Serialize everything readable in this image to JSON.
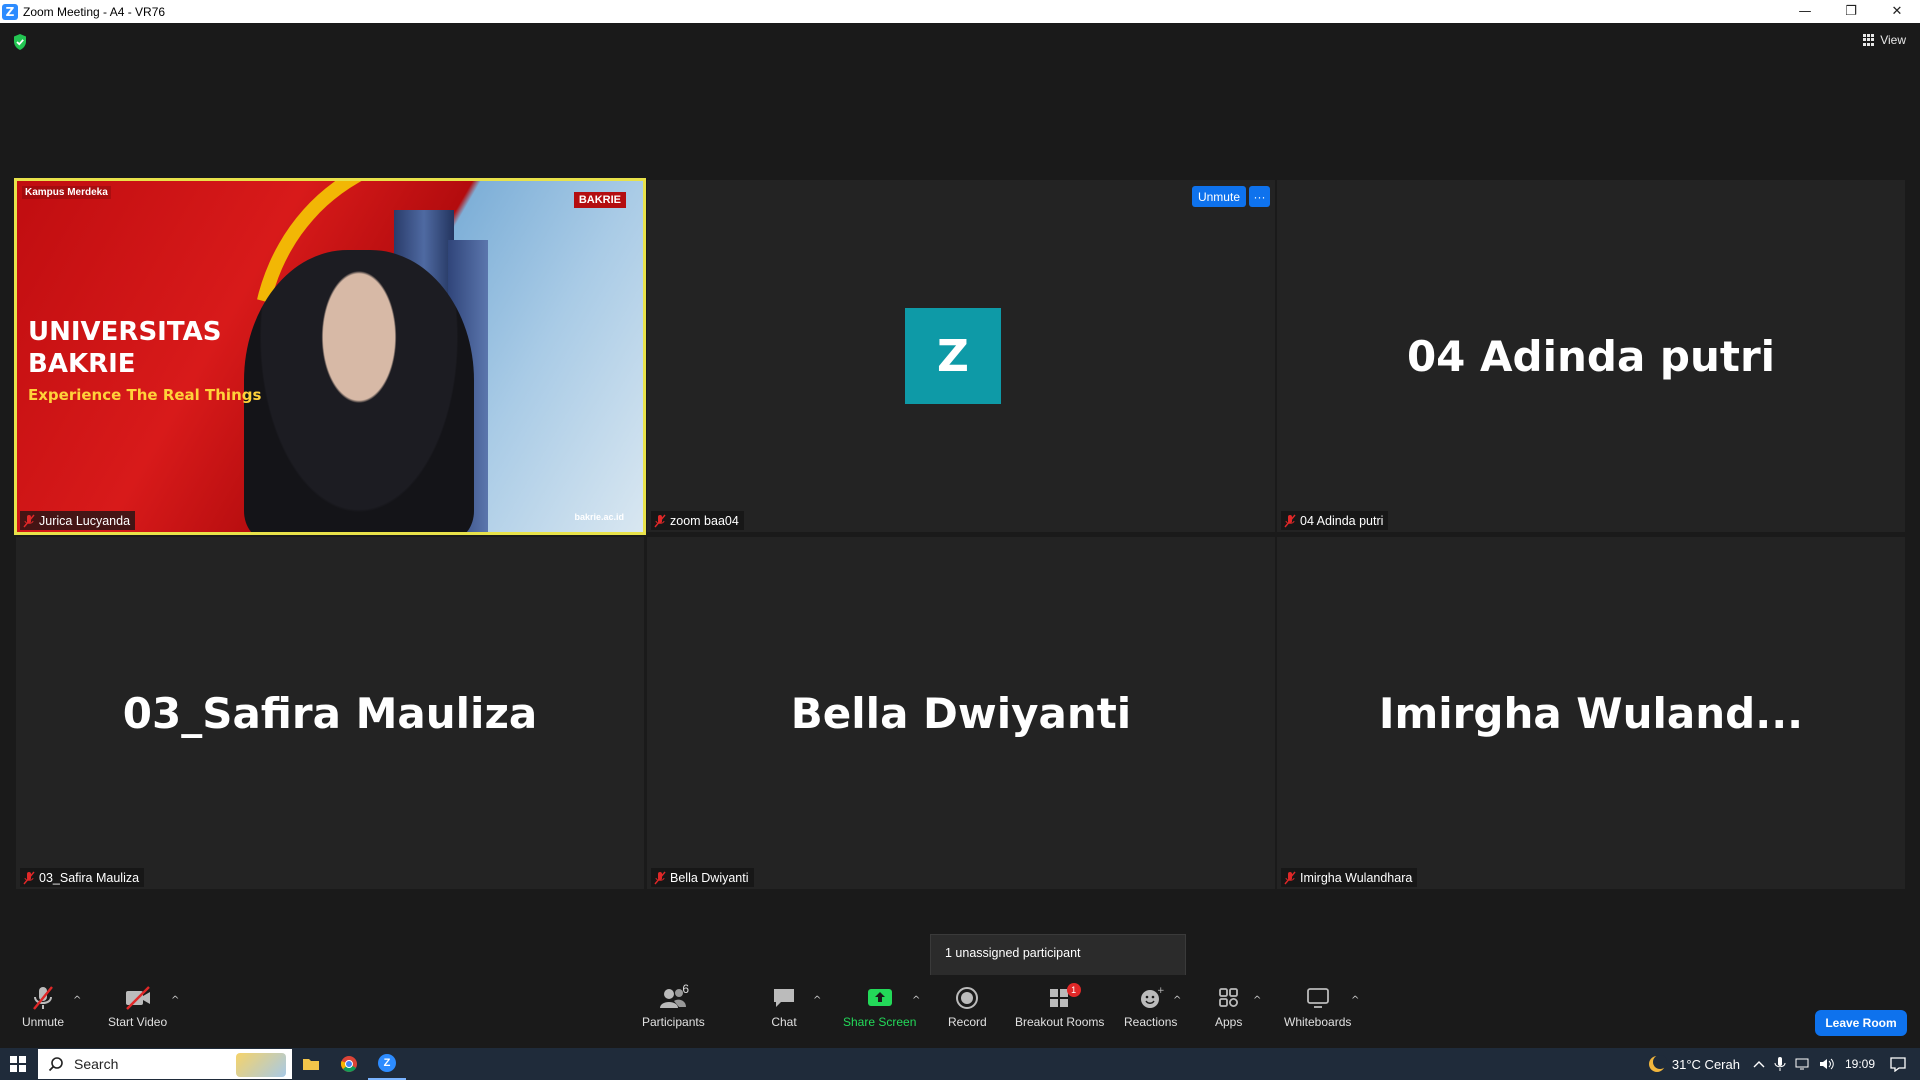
{
  "window": {
    "title": "Zoom Meeting - A4 - VR76",
    "app_letter": "Z",
    "minimize": "—",
    "restore": "❐",
    "close": "✕"
  },
  "meeting": {
    "view_label": "View",
    "tiles": [
      {
        "name": "Jurica Lucyanda",
        "type": "video"
      },
      {
        "name": "zoom baa04",
        "type": "avatar",
        "avatar_letter": "Z",
        "unmute_label": "Unmute",
        "more_label": "···"
      },
      {
        "name": "04 Adinda putri",
        "type": "name",
        "display": "04 Adinda putri"
      },
      {
        "name": "03_Safira Mauliza",
        "type": "name",
        "display": "03_Safira Mauliza"
      },
      {
        "name": "Bella Dwiyanti",
        "type": "name",
        "display": "Bella Dwiyanti"
      },
      {
        "name": "Imirgha Wulandhara",
        "type": "name",
        "display": "Imirgha  Wuland..."
      }
    ],
    "video_overlay": {
      "university_line1": "UNIVERSITAS",
      "university_line2": "BAKRIE",
      "tagline": "Experience The Real Things",
      "logo_left": "Kampus Merdeka",
      "logo_right": "BAKRIE",
      "site": "bakrie.ac.id"
    },
    "tooltip": "1 unassigned participant"
  },
  "toolbar": {
    "unmute": "Unmute",
    "start_video": "Start Video",
    "participants": "Participants",
    "participants_count": "6",
    "chat": "Chat",
    "share_screen": "Share Screen",
    "record": "Record",
    "breakout_rooms": "Breakout Rooms",
    "breakout_badge": "1",
    "reactions": "Reactions",
    "apps": "Apps",
    "whiteboards": "Whiteboards",
    "leave_room": "Leave Room",
    "caret": "^"
  },
  "taskbar": {
    "search_placeholder": "Search",
    "weather": "31°C  Cerah",
    "time": "19:09"
  },
  "colors": {
    "zoom_blue": "#0e72ed",
    "active_speaker": "#e8e24a",
    "share_green": "#23d959",
    "avatar_teal": "#0e9aa7"
  }
}
